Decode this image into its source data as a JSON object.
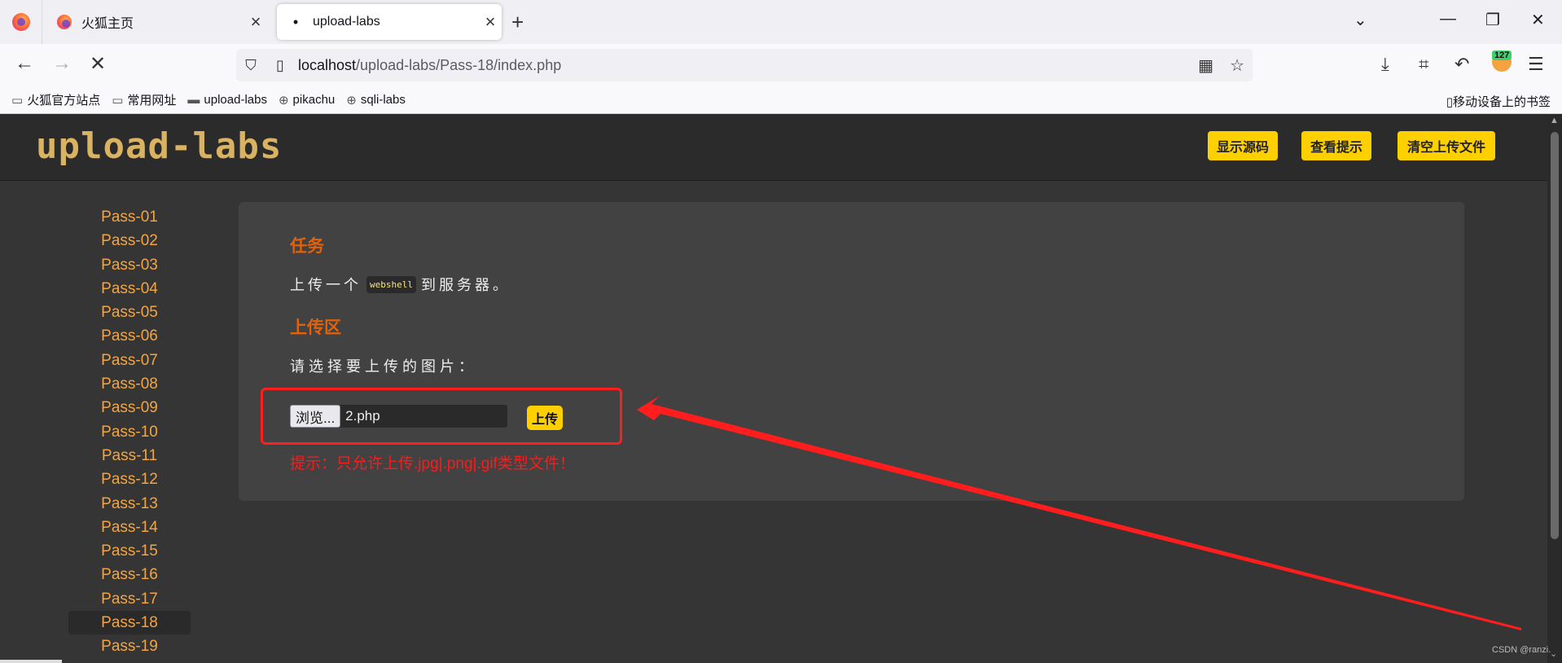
{
  "browser": {
    "tabs": [
      {
        "label": "火狐主页",
        "active": false
      },
      {
        "label": "upload-labs",
        "active": true
      }
    ],
    "url_host": "localhost",
    "url_path": "/upload-labs/Pass-18/index.php",
    "extension_badge": "127",
    "bookmarks": [
      "火狐官方站点",
      "常用网址",
      "upload-labs",
      "pikachu",
      "sqli-labs"
    ],
    "mobile_bookmarks": "移动设备上的书签"
  },
  "header": {
    "logo": "upload-labs",
    "buttons": [
      "显示源码",
      "查看提示",
      "清空上传文件"
    ]
  },
  "sidebar": {
    "items": [
      "Pass-01",
      "Pass-02",
      "Pass-03",
      "Pass-04",
      "Pass-05",
      "Pass-06",
      "Pass-07",
      "Pass-08",
      "Pass-09",
      "Pass-10",
      "Pass-11",
      "Pass-12",
      "Pass-13",
      "Pass-14",
      "Pass-15",
      "Pass-16",
      "Pass-17",
      "Pass-18",
      "Pass-19"
    ],
    "active": "Pass-18"
  },
  "main": {
    "task_title": "任务",
    "task_before": "上传一个",
    "task_code": "webshell",
    "task_after": "到服务器。",
    "upload_title": "上传区",
    "prompt": "请选择要上传的图片：",
    "browse_label": "浏览...",
    "file_name": "2.php",
    "upload_label": "上传",
    "hint": "提示：只允许上传.jpg|.png|.gif类型文件！"
  },
  "watermark": "CSDN @ranzi.",
  "colors": {
    "accent_yellow": "#ffd000",
    "sidebar_link": "#f4a541",
    "section_title": "#e36209",
    "hint_red": "#ff1a1a",
    "annotation_red": "#ff1d1d"
  }
}
